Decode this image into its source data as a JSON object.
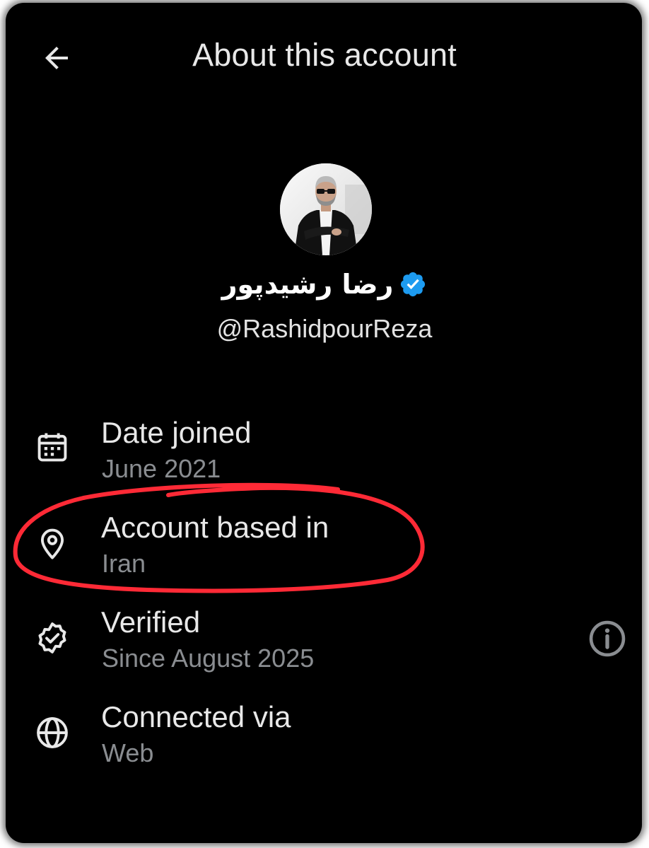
{
  "header": {
    "back_icon": "arrow-left-icon",
    "title": "About this account"
  },
  "profile": {
    "name": "رضا رشیدپور",
    "verified_badge_color": "#1d9bf0",
    "handle": "@RashidpourReza"
  },
  "details": [
    {
      "icon": "calendar-icon",
      "label": "Date joined",
      "value": "June 2021"
    },
    {
      "icon": "location-pin-icon",
      "label": "Account based in",
      "value": "Iran"
    },
    {
      "icon": "verified-badge-icon",
      "label": "Verified",
      "value": "Since August 2025",
      "action_icon": "info-icon"
    },
    {
      "icon": "globe-icon",
      "label": "Connected via",
      "value": "Web"
    }
  ],
  "colors": {
    "background": "#000000",
    "primary_text": "#e8e8e8",
    "secondary_text": "#8a8d91",
    "annotation": "#ff2a36"
  }
}
